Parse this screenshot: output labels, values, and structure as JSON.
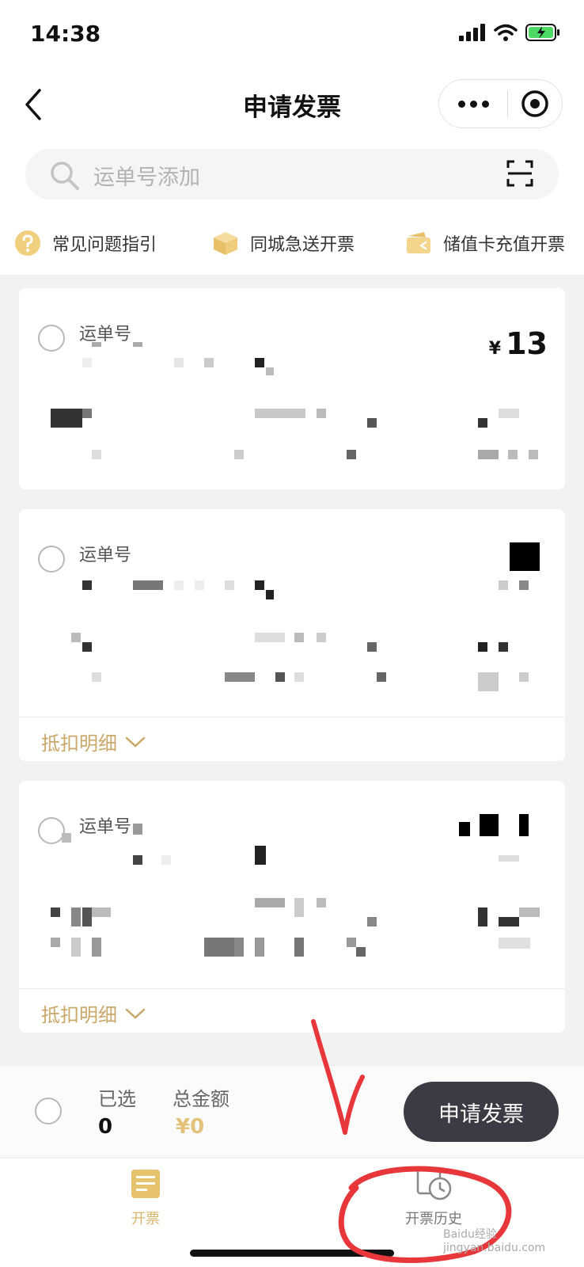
{
  "status_bar": {
    "time": "14:38"
  },
  "header": {
    "title": "申请发票"
  },
  "search": {
    "placeholder": "运单号添加"
  },
  "quick_links": [
    {
      "label": "常见问题指引",
      "icon": "question-icon"
    },
    {
      "label": "同城急送开票",
      "icon": "box-icon"
    },
    {
      "label": "储值卡充值开票",
      "icon": "wallet-icon"
    }
  ],
  "cards": [
    {
      "label": "运单号",
      "amount": "13",
      "currency": "¥",
      "detail": ""
    },
    {
      "label": "运单号",
      "amount": "",
      "currency": "",
      "detail": "抵扣明细"
    },
    {
      "label": "运单号",
      "amount": "",
      "currency": "",
      "detail": "抵扣明细"
    }
  ],
  "bottom_bar": {
    "selected_label": "已选",
    "selected_count": "0",
    "total_label": "总金额",
    "total_value": "¥0",
    "apply_button": "申请发票"
  },
  "tabs": [
    {
      "label": "开票",
      "icon": "invoice-icon",
      "active": true
    },
    {
      "label": "开票历史",
      "icon": "history-icon",
      "active": false
    }
  ],
  "colors": {
    "accent": "#c9a86a",
    "gold": "#e3c27b",
    "button": "#3b3b43",
    "annotation": "#e8373a"
  },
  "watermark": "Baidu经验 jingyan.baidu.com"
}
